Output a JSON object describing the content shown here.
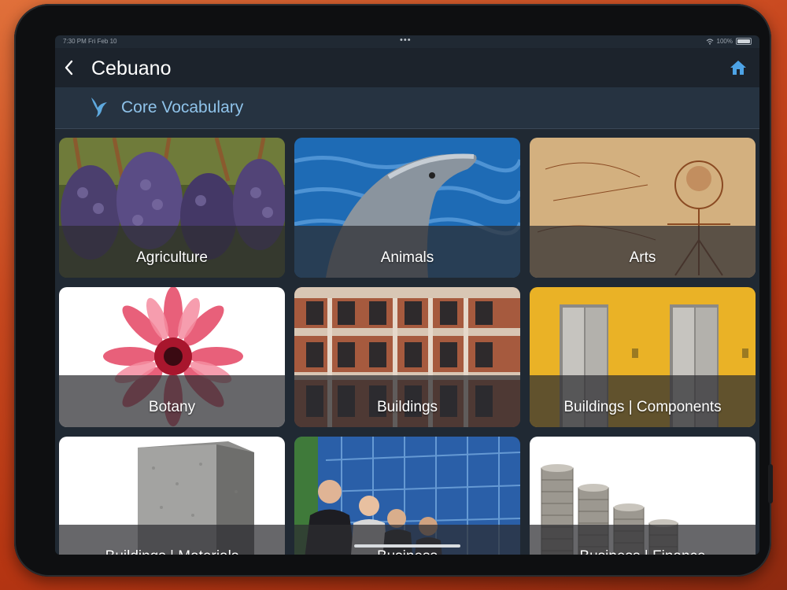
{
  "statusbar": {
    "time": "7:30 PM  Fri Feb 10",
    "dots": "•••",
    "battery": "100%"
  },
  "navbar": {
    "title": "Cebuano"
  },
  "subheader": {
    "title": "Core Vocabulary"
  },
  "categories": [
    {
      "label": "Agriculture"
    },
    {
      "label": "Animals"
    },
    {
      "label": "Arts"
    },
    {
      "label": "Botany"
    },
    {
      "label": "Buildings"
    },
    {
      "label": "Buildings | Components"
    },
    {
      "label": "Buildings | Materials"
    },
    {
      "label": "Business"
    },
    {
      "label": "Business | Finance"
    }
  ],
  "colors": {
    "accent": "#8fc3ea",
    "navbar": "#1c232c",
    "background": "#202933"
  }
}
